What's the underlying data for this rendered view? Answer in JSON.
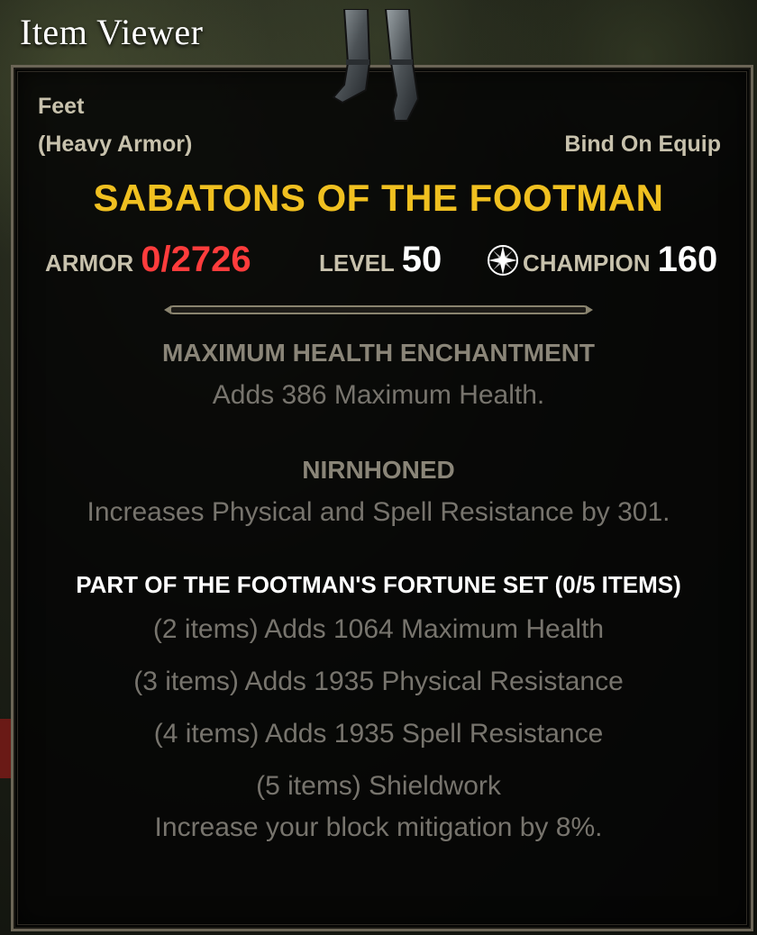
{
  "window": {
    "title": "Item Viewer"
  },
  "item": {
    "slot": "Feet",
    "armor_type": "(Heavy Armor)",
    "bind": "Bind On Equip",
    "name": "SABATONS OF THE FOOTMAN",
    "icon": "sabatons-boots-icon"
  },
  "stats": {
    "armor_label": "ARMOR",
    "armor_value": "0/2726",
    "level_label": "LEVEL",
    "level_value": "50",
    "champion_label": "CHAMPION",
    "champion_value": "160",
    "champion_icon": "champion-star-icon"
  },
  "enchantment": {
    "title": "MAXIMUM HEALTH ENCHANTMENT",
    "text": "Adds 386 Maximum Health."
  },
  "trait": {
    "title": "NIRNHONED",
    "text": "Increases Physical and Spell Resistance by 301."
  },
  "set": {
    "title": "PART OF THE FOOTMAN'S FORTUNE SET (0/5 ITEMS)",
    "bonuses": [
      "(2 items) Adds 1064 Maximum Health",
      "(3 items) Adds 1935 Physical Resistance",
      "(4 items) Adds 1935 Spell Resistance",
      "(5 items) Shieldwork",
      "Increase your block mitigation by 8%."
    ]
  },
  "colors": {
    "item_name": "#f0c020",
    "armor_value": "#ff3c3c",
    "set_title": "#ffffff",
    "inactive_text": "#77746d"
  }
}
